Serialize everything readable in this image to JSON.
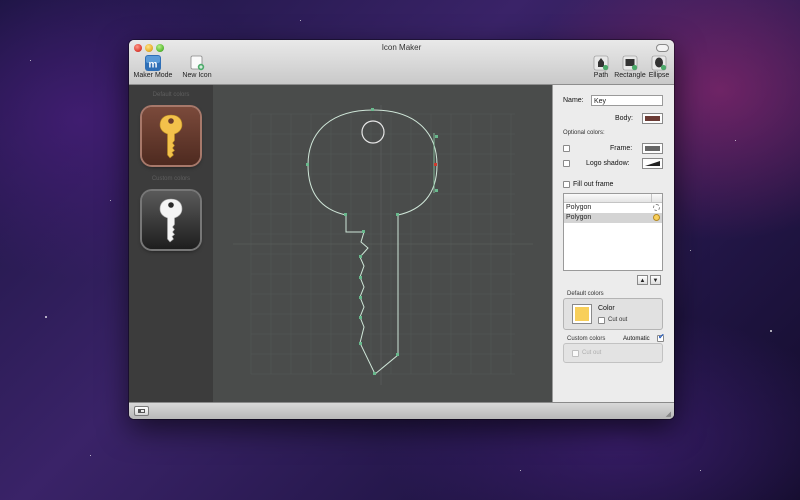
{
  "window": {
    "title": "Icon Maker"
  },
  "toolbar": {
    "maker_mode": "Maker Mode",
    "new_icon": "New Icon",
    "path": "Path",
    "rectangle": "Rectangle",
    "ellipse": "Ellipse"
  },
  "sidebar": {
    "default_colors": "Default colors",
    "custom_colors": "Custom colors"
  },
  "inspector": {
    "name_label": "Name:",
    "name_value": "Key",
    "body_label": "Body:",
    "optional_colors": "Optional colors:",
    "frame_label": "Frame:",
    "logo_shadow_label": "Logo shadow:",
    "fill_out_frame": "Fill out frame",
    "shapes": [
      "Polygon",
      "Polygon"
    ],
    "default_colors": "Default colors",
    "color_label": "Color",
    "cut_out": "Cut out",
    "custom_colors": "Custom colors",
    "automatic": "Automatic",
    "cut_out_disabled": "Cut out"
  },
  "colors": {
    "body": "#6b3b35",
    "frame": "#666666",
    "color_swatch": "#f8cf5a",
    "accent": "#2a5fbf",
    "selection_handle": "#d03a2e"
  }
}
